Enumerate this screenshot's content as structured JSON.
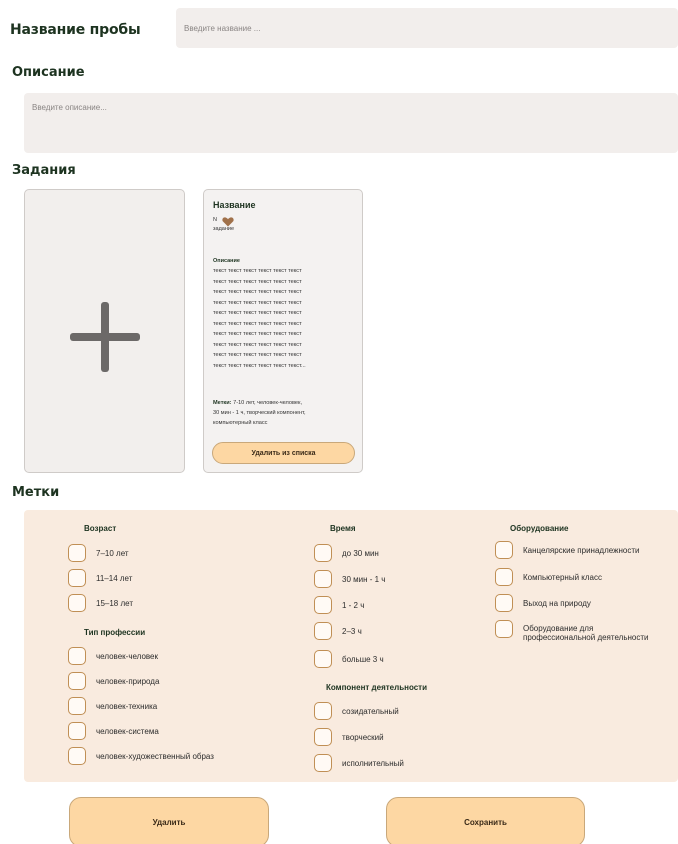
{
  "form": {
    "name_label": "Название пробы",
    "name_placeholder": "Введите название ...",
    "description_label": "Описание",
    "description_placeholder": "Введите описание..."
  },
  "tasks": {
    "section_label": "Задания",
    "add_icon": "plus-icon",
    "card": {
      "title": "Название",
      "number": "N",
      "like_icon": "heart-icon",
      "subtitle": "задание",
      "description_label": "Описание",
      "description_lines": [
        "текст текст текст текст текст текст",
        "текст текст текст текст текст текст",
        "текст текст текст текст текст текст",
        "текст текст текст текст текст текст",
        "текст текст текст текст текст текст",
        "текст текст текст текст текст текст",
        "текст текст текст текст текст текст",
        "текст текст текст текст текст текст",
        "текст текст текст текст текст текст",
        "текст текст текст текст текст текст..."
      ],
      "tags_label": "Метки:",
      "tags_text_lines": [
        " 7-10 лет, человек-человек,",
        "30 мин - 1 ч, творческий компонент,",
        "компьютерный класс"
      ],
      "remove_button": "Удалить из списка"
    }
  },
  "tags": {
    "section_label": "Метки",
    "age": {
      "title": "Возраст",
      "options": [
        "7–10 лет",
        "11–14 лет",
        "15–18 лет"
      ]
    },
    "profession": {
      "title": "Тип профессии",
      "options": [
        "человек-человек",
        "человек-природа",
        "человек-техника",
        "человек-система",
        "человек-художественный образ"
      ]
    },
    "time": {
      "title": "Время",
      "options": [
        "до 30 мин",
        "30 мин - 1 ч",
        "1 - 2 ч",
        "2–3 ч",
        "больше 3 ч"
      ]
    },
    "activity": {
      "title": "Компонент деятельности",
      "options": [
        "созидательный",
        "творческий",
        "исполнительный"
      ]
    },
    "equipment": {
      "title": "Оборудование",
      "options": [
        "Канцелярские принадлежности",
        "Компьютерный класс",
        "Выход на природу",
        "Оборудование для",
        "профессиональной деятельности"
      ]
    }
  },
  "actions": {
    "delete_button": "Удалить",
    "save_button": "Сохранить"
  },
  "colors": {
    "accent": "#fdd7a3",
    "checkbox_border": "#c08f55",
    "panel_bg": "#f9ebdf",
    "heading": "#1d3320"
  }
}
